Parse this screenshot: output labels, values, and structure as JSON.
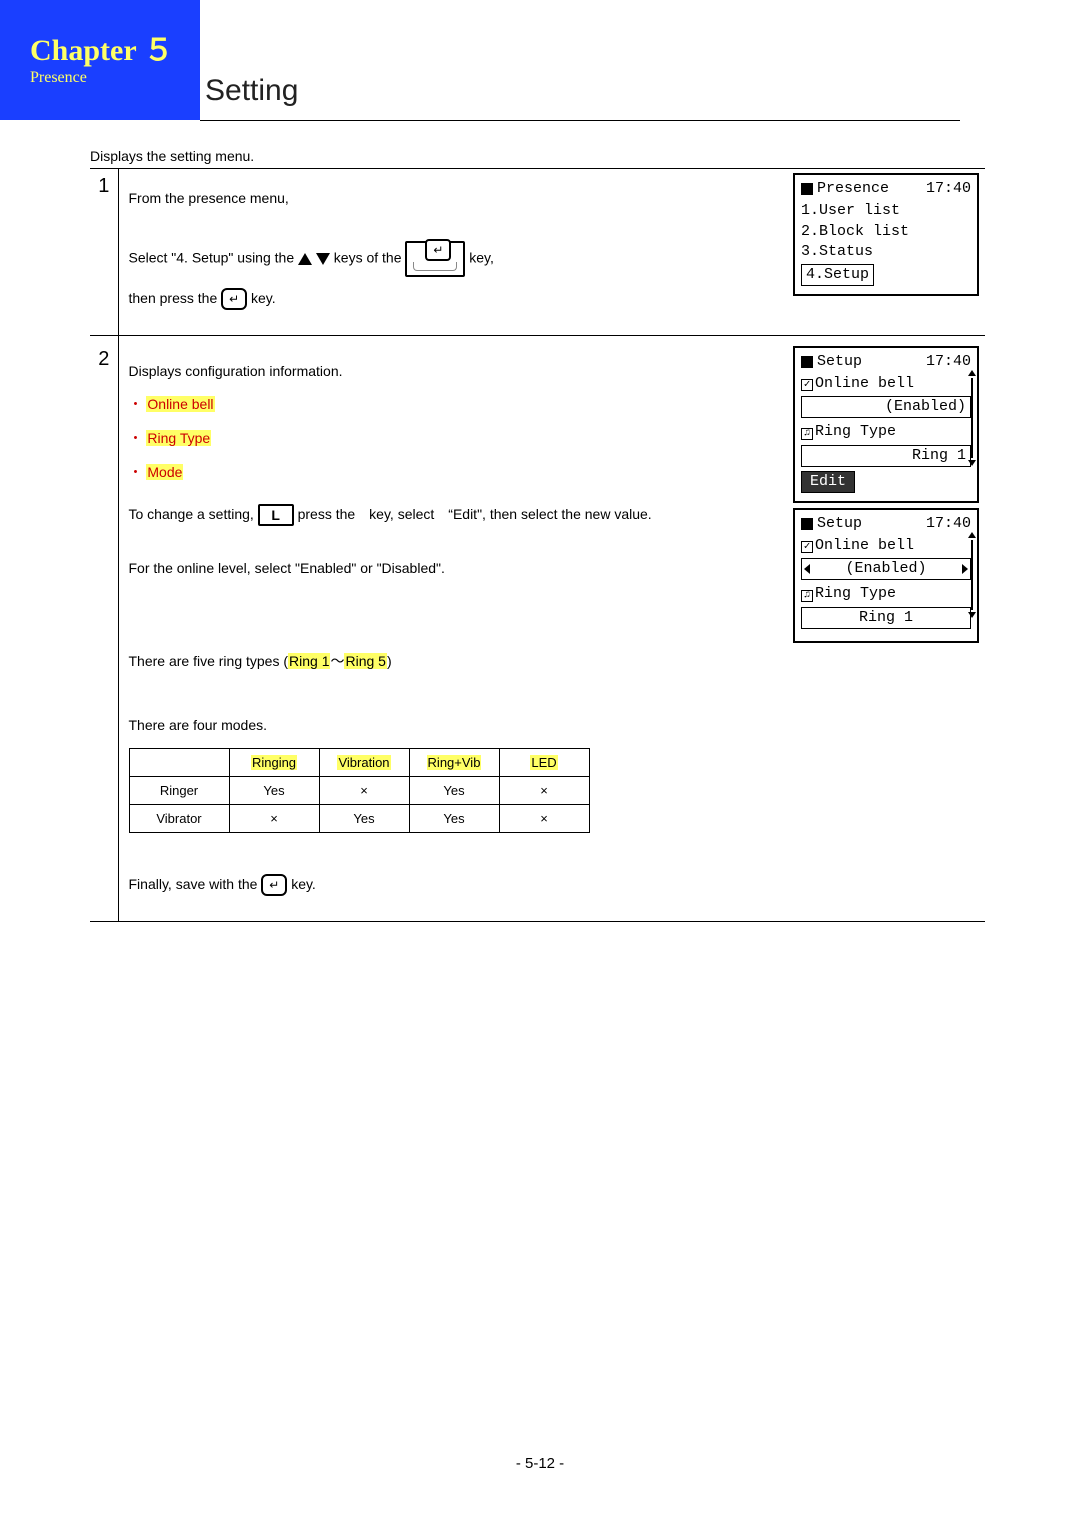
{
  "header": {
    "chapter": "Chapter ５",
    "section": "Presence",
    "title": "Setting"
  },
  "intro": "Displays the setting menu.",
  "step1": {
    "num": "1",
    "line1": "From the presence menu,",
    "line2a": "Select \"4. Setup\" using the ",
    "line2b": " keys of the ",
    "line2c": " key,",
    "line3a": "then press the ",
    "line3b": " key."
  },
  "screen1": {
    "title": "Presence",
    "time": "17:40",
    "items": [
      "1.User list",
      "2.Block list",
      "3.Status"
    ],
    "selected": "4.Setup"
  },
  "step2": {
    "num": "2",
    "line1": "Displays configuration information.",
    "bullet1": "Online bell",
    "bullet2": "Ring Type",
    "bullet3": "Mode",
    "changeA": "To change a setting, ",
    "keyL": "L",
    "changeB": " press the　key, select　“Edit\", then select the new value.",
    "onlineLine": "For the online level, select \"Enabled\" or \"Disabled\".",
    "ringLineA": "There are five ring types (",
    "ringHL1": "Ring 1",
    "ringTilde": "～",
    "ringHL2": "Ring 5",
    "ringLineB": ")",
    "modesIntro": "There are four modes.",
    "finalA": "Finally, save with the ",
    "finalB": " key."
  },
  "screen2a": {
    "title": "Setup",
    "time": "17:40",
    "row1": "Online bell",
    "val1": "(Enabled)",
    "row2": "Ring Type",
    "val2": "Ring 1",
    "edit": "Edit"
  },
  "screen2b": {
    "title": "Setup",
    "time": "17:40",
    "row1": "Online bell",
    "val1": "(Enabled)",
    "row2": "Ring Type",
    "val2": "Ring 1"
  },
  "modeTable": {
    "headers": [
      "Ringing",
      "Vibration",
      "Ring+Vib",
      "LED"
    ],
    "rows": [
      {
        "label": "Ringer",
        "cells": [
          "Yes",
          "×",
          "Yes",
          "×"
        ]
      },
      {
        "label": "Vibrator",
        "cells": [
          "×",
          "Yes",
          "Yes",
          "×"
        ]
      }
    ]
  },
  "pageNumber": "- 5-12 -",
  "icons": {
    "enter": "↵",
    "note": "♫",
    "check": "✓"
  }
}
